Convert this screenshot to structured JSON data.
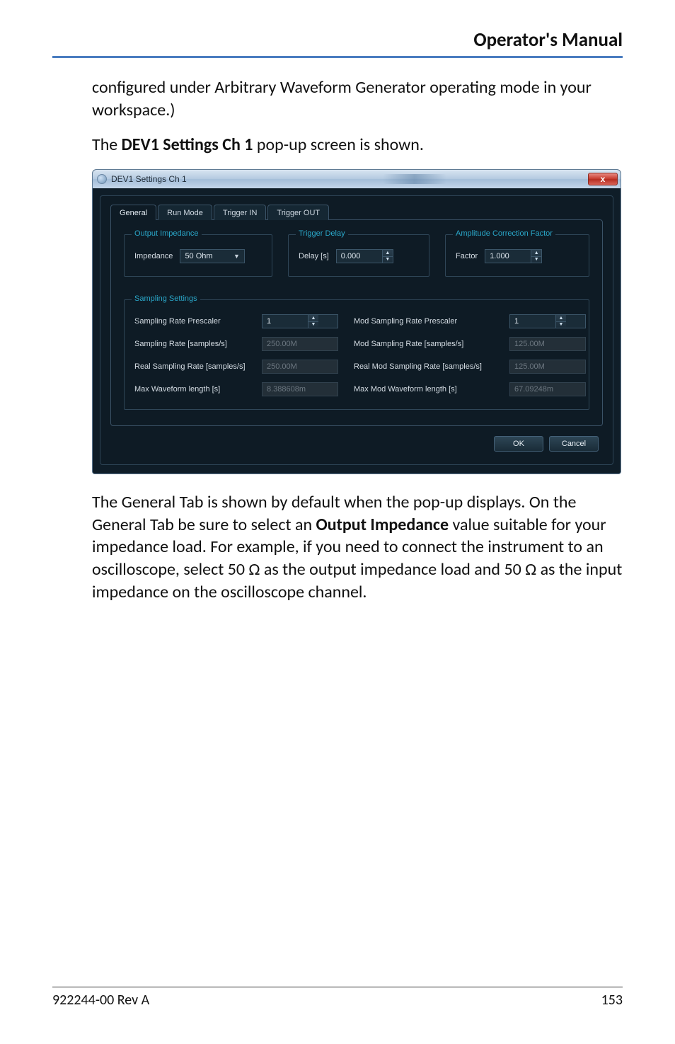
{
  "page": {
    "header": "Operator's Manual",
    "paragraph1": "configured under Arbitrary Waveform Generator operating mode in your workspace.)",
    "paragraph2_pre": "The ",
    "paragraph2_bold": "DEV1 Settings Ch 1",
    "paragraph2_post": " pop-up screen is shown.",
    "paragraph3_a": "The General Tab is shown by default when the pop-up displays. On the General Tab be sure to select an ",
    "paragraph3_bold": "Output Impedance",
    "paragraph3_b": " value suitable for your impedance load. For example, if you need to connect the instrument to an oscilloscope, select 50 Ω as the output impedance load and 50 Ω as the input impedance on the oscilloscope channel.",
    "footer_left": "922244-00 Rev A",
    "footer_right": "153"
  },
  "dialog": {
    "title": "DEV1 Settings Ch 1",
    "close_glyph": "x",
    "tabs": [
      "General",
      "Run Mode",
      "Trigger IN",
      "Trigger OUT"
    ],
    "groups": {
      "output_impedance": {
        "title": "Output Impedance",
        "label": "Impedance",
        "value": "50 Ohm"
      },
      "trigger_delay": {
        "title": "Trigger Delay",
        "label": "Delay [s]",
        "value": "0.000"
      },
      "amp_corr": {
        "title": "Amplitude Correction Factor",
        "label": "Factor",
        "value": "1.000"
      },
      "sampling": {
        "title": "Sampling Settings",
        "rows": {
          "r1l": "Sampling Rate Prescaler",
          "r1lv": "1",
          "r1r": "Mod Sampling Rate Prescaler",
          "r1rv": "1",
          "r2l": "Sampling Rate [samples/s]",
          "r2lv": "250.00M",
          "r2r": "Mod Sampling Rate [samples/s]",
          "r2rv": "125.00M",
          "r3l": "Real Sampling Rate [samples/s]",
          "r3lv": "250.00M",
          "r3r": "Real Mod Sampling Rate [samples/s]",
          "r3rv": "125.00M",
          "r4l": "Max Waveform length [s]",
          "r4lv": "8.388608m",
          "r4r": "Max Mod Waveform length [s]",
          "r4rv": "67.09248m"
        }
      }
    },
    "buttons": {
      "ok": "OK",
      "cancel": "Cancel"
    }
  }
}
